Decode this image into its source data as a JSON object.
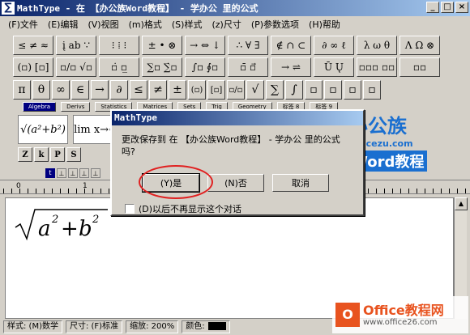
{
  "window": {
    "icon": "∑",
    "title": "MathType - 在 【办公族Word教程】 - 学办公 里的公式",
    "buttons": [
      "_",
      "□",
      "×"
    ]
  },
  "menu": [
    "(F)文件",
    "(E)编辑",
    "(V)视图",
    "(m)格式",
    "(S)样式",
    "(z)尺寸",
    "(P)参数选项",
    "(H)帮助"
  ],
  "toolbar_row1": [
    "≤ ≠ ≈",
    "į ab ∵",
    "⁝ ⁞ ⁝",
    "± • ⊗",
    "→ ⇔ ↓",
    "∴ ∀ ∃",
    "∉ ∩ ⊂",
    "∂ ∞ ℓ",
    "λ ω θ",
    "Λ Ω ⊗"
  ],
  "toolbar_row2": [
    "(▫) [▫]",
    "▫/▫ √▫",
    "▫̇ ▫̲",
    "∑▫ ∑̇▫",
    "∫▫ ∮▫",
    "▫̄ ▫⃗",
    "→ ⇌",
    "Ū Ų",
    "▫▫▫ ▫▫",
    "▫▫"
  ],
  "symbol_row": [
    "π",
    "θ",
    "∞",
    "∈",
    "→",
    "∂",
    "≤",
    "≠",
    "±",
    "(▫)",
    "[▫]",
    "▫/▫",
    "√",
    "∑",
    "∫",
    "▫",
    "▫",
    "▫",
    "▫"
  ],
  "tabs": [
    "Algebra",
    "Derivs",
    "Statistics",
    "Matrices",
    "Sets",
    "Trig",
    "Geometry",
    "标签 8",
    "标签 9"
  ],
  "templates": [
    "√(a²+b²)",
    "lim x→∞"
  ],
  "small_buttons": [
    "Z",
    "k",
    "P",
    "S"
  ],
  "ruler": {
    "zero": "0",
    "one": "1"
  },
  "editor": {
    "formula_html": "√a²+b²"
  },
  "statusbar": {
    "style": "样式: (M)数学",
    "size": "尺寸: (F)标准",
    "zoom": "缩放: 200%",
    "color": "颜色:"
  },
  "dialog": {
    "title": "MathType",
    "message": "更改保存到 在 【办公族Word教程】 - 学办公 里的公式 吗?",
    "yes": "(Y)是",
    "no": "(N)否",
    "cancel": "取消",
    "checkbox_label": "(D)以后不再显示这个对话"
  },
  "watermark_top": {
    "brand": "办公族",
    "url": "Officezu.com",
    "word": "Word教程"
  },
  "watermark_bottom": {
    "logo": "O",
    "brand": "Office教程网",
    "url": "www.office26.com"
  }
}
